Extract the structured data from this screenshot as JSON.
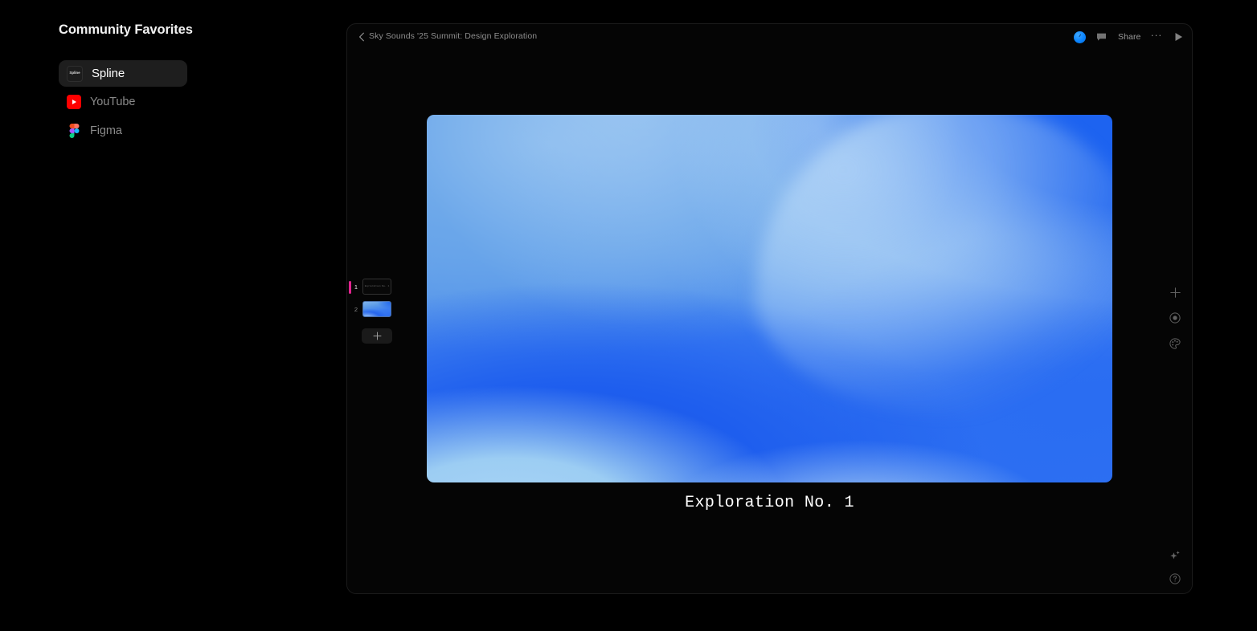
{
  "sidebar": {
    "title": "Community Favorites",
    "items": [
      {
        "label": "Spline",
        "icon": "spline-icon",
        "icon_text": "Spline",
        "active": true
      },
      {
        "label": "YouTube",
        "icon": "youtube-icon",
        "active": false
      },
      {
        "label": "Figma",
        "icon": "figma-icon",
        "active": false
      }
    ]
  },
  "app": {
    "topbar": {
      "back_icon": "chevron-left-icon",
      "document_title": "Sky Sounds '25 Summit: Design Exploration",
      "avatar_icon": "user-avatar-clock-icon",
      "comment_icon": "comment-icon",
      "share_label": "Share",
      "more_label": "···",
      "play_icon": "play-icon"
    },
    "stage": {
      "caption": "Exploration No. 1",
      "artwork_name": "blue-gradient-mesh"
    },
    "thumbnails": {
      "add_label": "+",
      "add_icon": "plus-icon",
      "slides": [
        {
          "number": "1",
          "kind": "dark",
          "mini_caption": "Exploration No. 1",
          "active": true
        },
        {
          "number": "2",
          "kind": "artwork",
          "mini_caption": "",
          "active": false
        }
      ]
    },
    "tools": {
      "right_rail": [
        {
          "icon": "plus-icon",
          "name": "add-object-button"
        },
        {
          "icon": "record-icon",
          "name": "record-button"
        },
        {
          "icon": "palette-icon",
          "name": "theme-button"
        }
      ],
      "bottom_rail": [
        {
          "icon": "sparkle-icon",
          "name": "ai-assist-button"
        },
        {
          "icon": "help-icon",
          "name": "help-button"
        }
      ]
    }
  },
  "colors": {
    "background": "#000000",
    "sidebar_active": "#1e1e1e",
    "accent_pink": "#e1238f",
    "accent_blue": "#0a84ff",
    "youtube_red": "#ff0000",
    "gradient_light": "#a9d4f5",
    "gradient_mid": "#5b9ae8",
    "gradient_deep": "#1d63f0"
  }
}
